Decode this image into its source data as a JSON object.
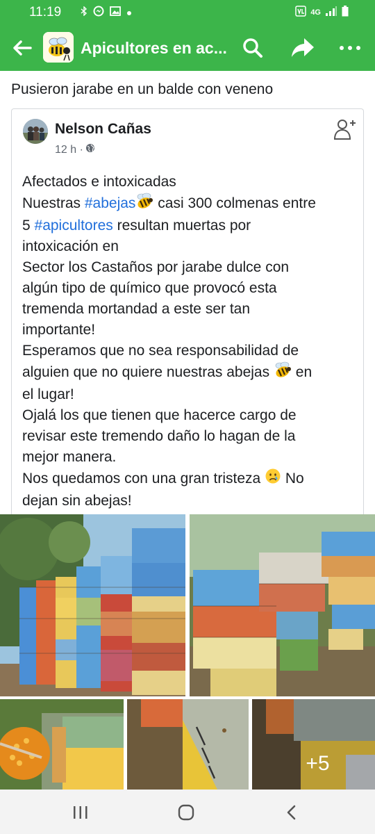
{
  "status_bar": {
    "time": "11:19",
    "left_icons": [
      "bluetooth-icon",
      "messenger-icon",
      "gallery-icon",
      "dot-icon"
    ],
    "right_icons": [
      "volte-icon",
      "4g-icon",
      "signal-icon",
      "battery-icon"
    ],
    "net_label": "4G"
  },
  "app_bar": {
    "group_title": "Apicultores en ac...",
    "accent_color": "#3cb54a"
  },
  "post": {
    "caption": "Pusieron jarabe en un balde con veneno",
    "author": "Nelson Cañas",
    "time": "12 h ·",
    "privacy": "globe-icon",
    "text": {
      "l1": "Afectados e intoxicadas",
      "l2_pre": "Nuestras ",
      "l2_tag": "#abejas",
      "l2_post": " casi 300 colmenas entre",
      "l3_pre": "5 ",
      "l3_tag": "#apicultores",
      "l3_post": " resultan muertas por",
      "l4": "intoxicación en",
      "l5": "Sector los Castaños por jarabe dulce con",
      "l6": "algún tipo de químico que provocó esta",
      "l7": "tremenda mortandad a este ser tan",
      "l8": "importante!",
      "l9": "Esperamos que no sea responsabilidad de",
      "l10_pre": "alguien que no quiere nuestras abejas ",
      "l10_post": " en",
      "l11": "el lugar!",
      "l12": "Ojalá los que tienen que hacerce cargo de",
      "l13": "revisar este tremendo daño lo hagan de la",
      "l14": "mejor manera.",
      "l15_pre": "Nos quedamos con una gran tristeza ",
      "l15_post": " No",
      "l16": "dejan sin abejas!"
    },
    "hashtag_color": "#216fdb",
    "photos": {
      "more_count": "+5"
    }
  },
  "nav_bar": {
    "buttons": [
      "recent-apps",
      "home",
      "back"
    ]
  }
}
